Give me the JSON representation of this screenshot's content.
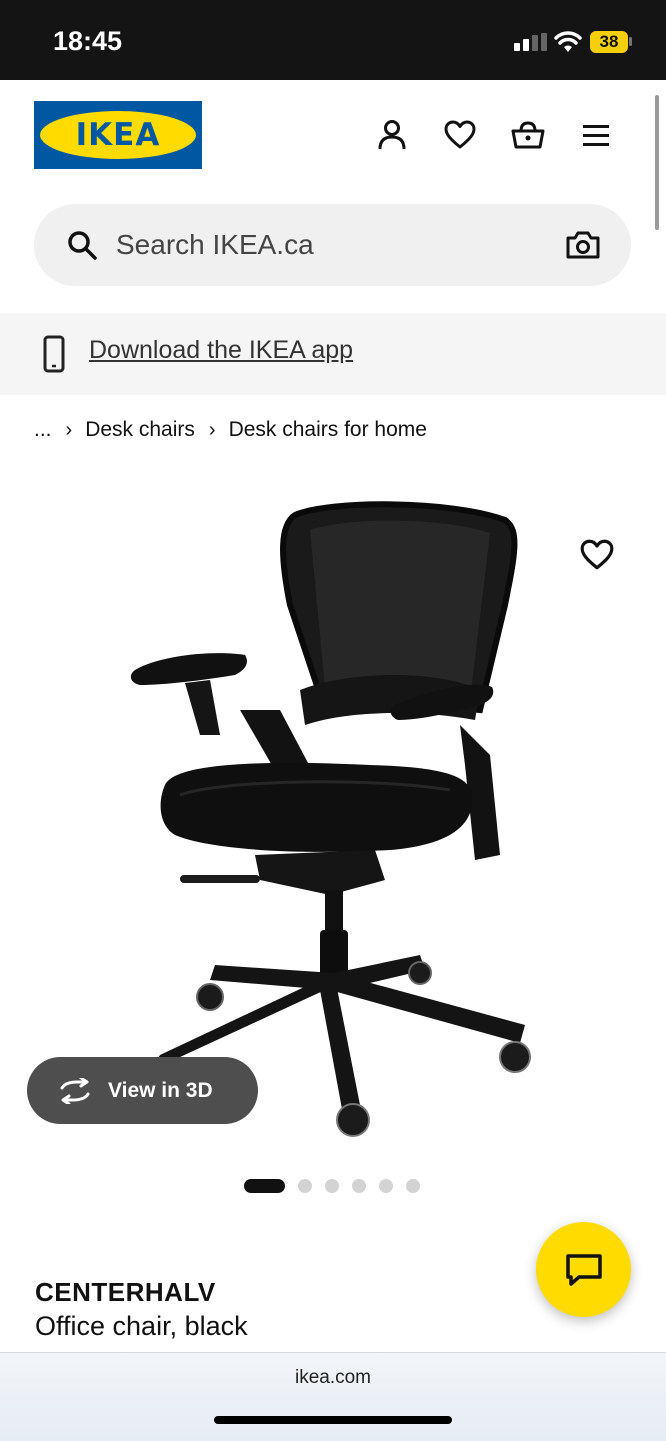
{
  "status_bar": {
    "time": "18:45",
    "battery": "38"
  },
  "header": {
    "logo_text": "IKEA",
    "logo_reg": "®"
  },
  "search": {
    "placeholder": "Search IKEA.ca"
  },
  "app_banner": {
    "link": "Download the IKEA app"
  },
  "breadcrumb": {
    "ellipsis": "...",
    "items": [
      "Desk chairs",
      "Desk chairs for home"
    ]
  },
  "gallery": {
    "view3d_label": "View in 3D",
    "dot_count": 6,
    "active_dot": 0
  },
  "product": {
    "name": "CENTERHALV",
    "description": "Office chair, black"
  },
  "browser": {
    "url": "ikea.com"
  },
  "colors": {
    "ikea_blue": "#0058a3",
    "ikea_yellow": "#ffdb00"
  }
}
